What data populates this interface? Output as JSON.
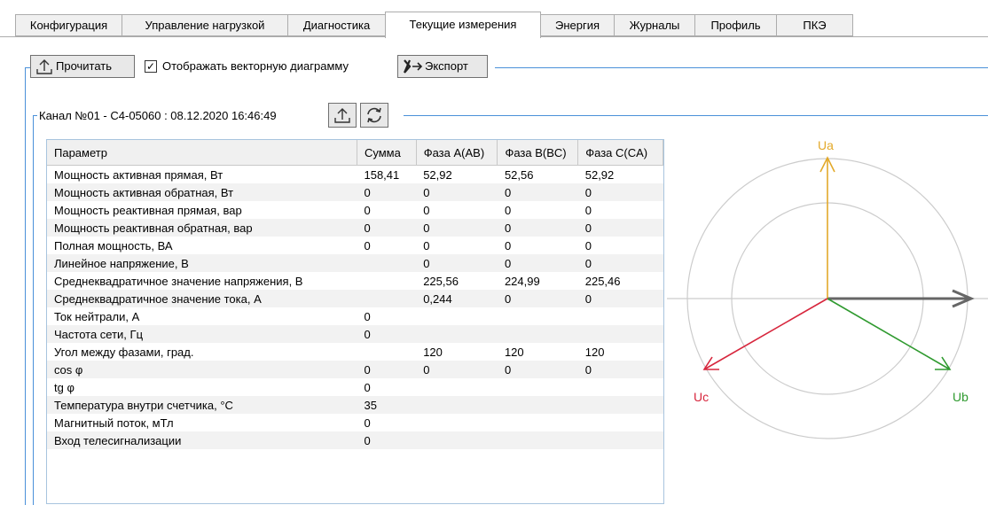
{
  "tabs": [
    {
      "label": "Конфигурация",
      "active": false
    },
    {
      "label": "Управление нагрузкой",
      "active": false
    },
    {
      "label": "Диагностика",
      "active": false
    },
    {
      "label": "Текущие измерения",
      "active": true
    },
    {
      "label": "Энергия",
      "active": false
    },
    {
      "label": "Журналы",
      "active": false
    },
    {
      "label": "Профиль",
      "active": false
    },
    {
      "label": "ПКЭ",
      "active": false
    }
  ],
  "toolbar": {
    "read_label": "Прочитать",
    "vector_checkbox_label": "Отображать векторную диаграмму",
    "vector_checked": true,
    "export_label": "Экспорт"
  },
  "channel": {
    "title": "Канал №01 - С4-05060 : 08.12.2020 16:46:49",
    "upload_icon": "upload-icon",
    "refresh_icon": "refresh-icon"
  },
  "table": {
    "columns": [
      "Параметр",
      "Сумма",
      "Фаза A(AB)",
      "Фаза B(BC)",
      "Фаза C(CA)"
    ],
    "rows": [
      [
        "Мощность активная прямая, Вт",
        "158,41",
        "52,92",
        "52,56",
        "52,92"
      ],
      [
        "Мощность активная обратная, Вт",
        "0",
        "0",
        "0",
        "0"
      ],
      [
        "Мощность реактивная прямая, вар",
        "0",
        "0",
        "0",
        "0"
      ],
      [
        "Мощность реактивная обратная, вар",
        "0",
        "0",
        "0",
        "0"
      ],
      [
        "Полная мощность, ВА",
        "0",
        "0",
        "0",
        "0"
      ],
      [
        "Линейное напряжение, В",
        "",
        "0",
        "0",
        "0"
      ],
      [
        "Среднеквадратичное значение напряжения, В",
        "",
        "225,56",
        "224,99",
        "225,46"
      ],
      [
        "Среднеквадратичное значение тока, А",
        "",
        "0,244",
        "0",
        "0"
      ],
      [
        "Ток нейтрали, А",
        "0",
        "",
        "",
        ""
      ],
      [
        "Частота сети, Гц",
        "0",
        "",
        "",
        ""
      ],
      [
        "Угол между фазами, град.",
        "",
        "120",
        "120",
        "120"
      ],
      [
        "cos φ",
        "0",
        "0",
        "0",
        "0"
      ],
      [
        "tg φ",
        "0",
        "",
        "",
        ""
      ],
      [
        "Температура внутри счетчика, °С",
        "35",
        "",
        "",
        ""
      ],
      [
        "Магнитный поток, мТл",
        "0",
        "",
        "",
        ""
      ],
      [
        "Вход телесигнализации",
        "0",
        "",
        "",
        ""
      ]
    ]
  },
  "vector": {
    "labels": {
      "ua": "Ua",
      "ub": "Ub",
      "uc": "Uc"
    },
    "colors": {
      "ua": "#e3a92a",
      "ub": "#2f9a2f",
      "uc": "#d7263d",
      "ref": "#666666",
      "circle": "#cccccc"
    }
  }
}
